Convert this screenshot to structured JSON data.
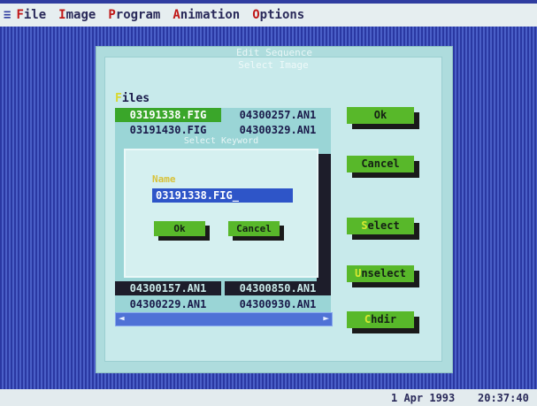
{
  "menubar": {
    "items": [
      {
        "hot": "F",
        "rest": "ile"
      },
      {
        "hot": "I",
        "rest": "mage"
      },
      {
        "hot": "P",
        "rest": "rogram"
      },
      {
        "hot": "A",
        "rest": "nimation"
      },
      {
        "hot": "O",
        "rest": "ptions"
      }
    ]
  },
  "outer_window": {
    "title": "Edit Sequence"
  },
  "dialog": {
    "title": "Select Image",
    "files_label_hot": "F",
    "files_label_rest": "iles",
    "files_col1": [
      "03191338.FIG",
      "03191430.FIG",
      "04300157.AN1",
      "04300229.AN1"
    ],
    "files_col2": [
      "04300257.AN1",
      "04300329.AN1",
      "04300850.AN1",
      "04300930.AN1"
    ],
    "buttons": {
      "ok": "Ok",
      "cancel": "Cancel",
      "select_hot": "S",
      "select_rest": "elect",
      "unselect_hot": "U",
      "unselect_rest": "nselect",
      "chdir_hot": "C",
      "chdir_rest": "hdir"
    }
  },
  "modal": {
    "title": "Select Keyword",
    "field_label": "Name",
    "field_value": "03191338.FIG_",
    "ok": "Ok",
    "cancel": "Cancel"
  },
  "statusbar": {
    "date": "1 Apr 1993",
    "time": "20:37:40"
  },
  "colors": {
    "desktop": "#2f3da0",
    "button": "#58b82a",
    "selection": "#3aa62a"
  }
}
